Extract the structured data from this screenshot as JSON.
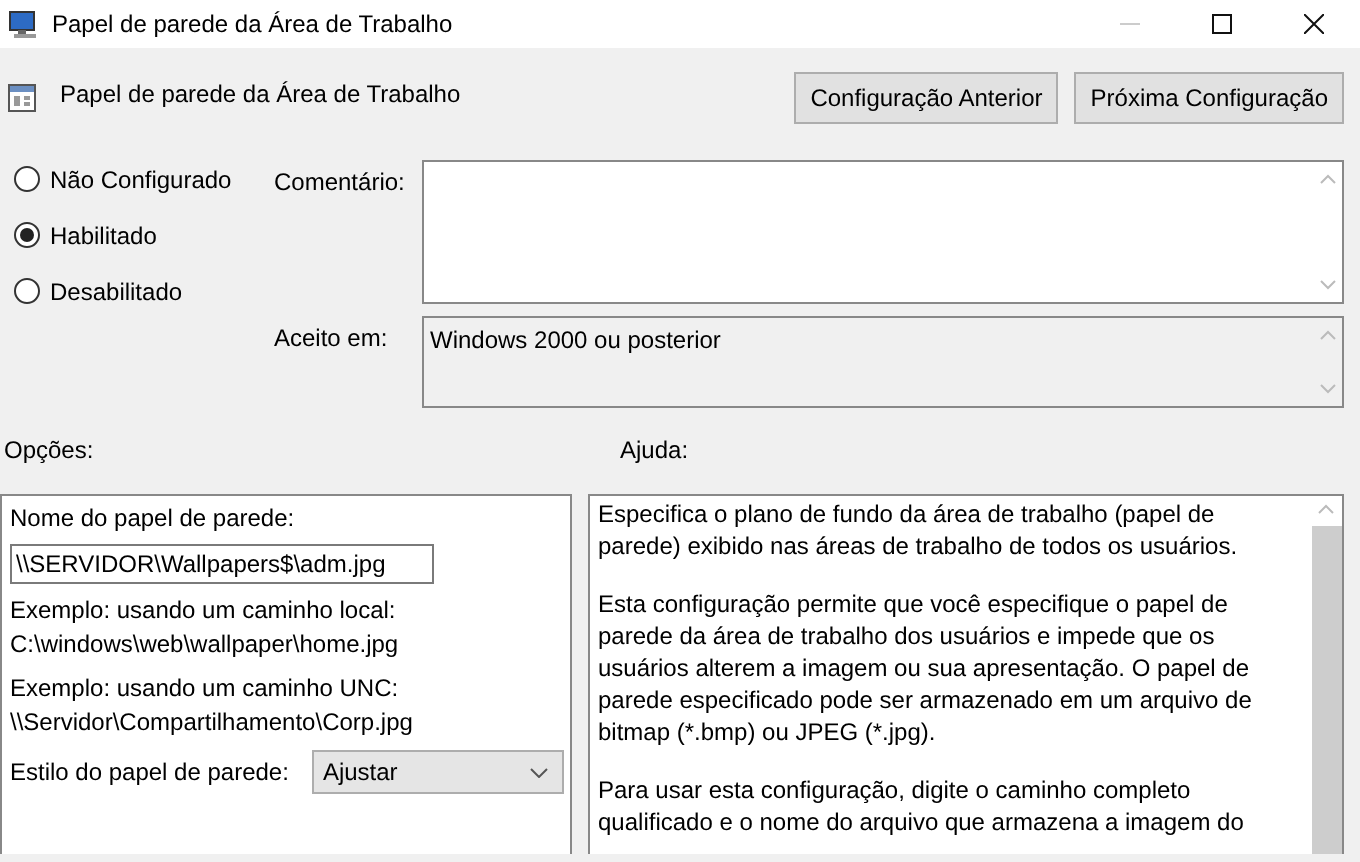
{
  "window": {
    "title": "Papel de parede da Área de Trabalho"
  },
  "header": {
    "title": "Papel de parede da Área de Trabalho",
    "buttons": [
      {
        "label": "Configuração Anterior"
      },
      {
        "label": "Próxima Configuração"
      }
    ]
  },
  "state_options": [
    {
      "label": "Não Configurado",
      "selected": false
    },
    {
      "label": "Habilitado",
      "selected": true
    },
    {
      "label": "Desabilitado",
      "selected": false
    }
  ],
  "comment": {
    "label": "Comentário:"
  },
  "supported_on": {
    "label": "Aceito em:",
    "value": "Windows 2000 ou posterior"
  },
  "options": {
    "label": "Opções:",
    "wallpaper_name": {
      "label": "Nome do papel de parede:",
      "value": "\\\\SERVIDOR\\Wallpapers$\\adm.jpg"
    },
    "examples": [
      "Exemplo: usando um caminho local:\nC:\\windows\\web\\wallpaper\\home.jpg",
      "Exemplo: usando um caminho UNC:\n\\\\Servidor\\Compartilhamento\\Corp.jpg"
    ],
    "wallpaper_style": {
      "label": "Estilo do papel de parede:",
      "value": "Ajustar"
    }
  },
  "help": {
    "label": "Ajuda:",
    "paragraphs": [
      "Especifica o plano de fundo da área de trabalho (papel de parede) exibido nas áreas de trabalho de todos os usuários.",
      "Esta configuração permite que você especifique o papel de parede da área de trabalho dos usuários e impede que os usuários alterem a imagem ou sua apresentação. O papel de parede especificado pode ser armazenado em um arquivo de bitmap (*.bmp) ou JPEG (*.jpg).",
      "Para usar esta configuração, digite o caminho completo qualificado e o nome do arquivo que armazena a imagem do"
    ]
  }
}
